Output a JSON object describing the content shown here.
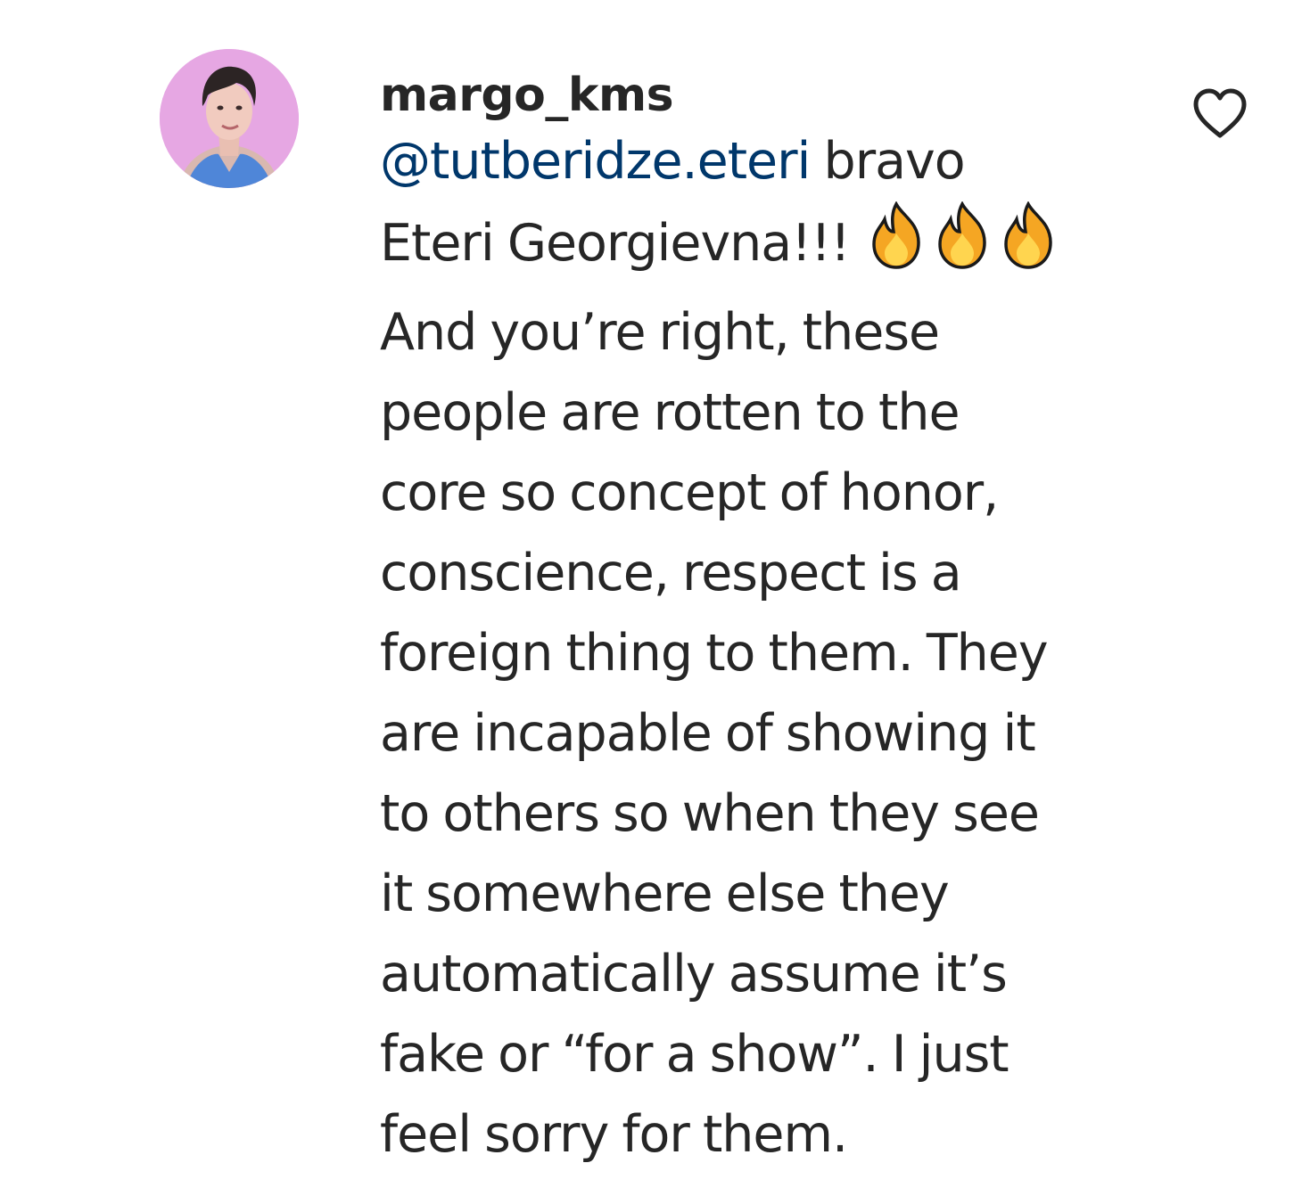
{
  "comment": {
    "username": "margo_kms",
    "mention": "@tutberidze.eteri",
    "text_line_1_after_mention": " bravo",
    "text_line_2": "Eteri Georgievna!!! ",
    "emoji": [
      "fire",
      "fire",
      "fire"
    ],
    "text_rest_lines": [
      "And you’re right, these",
      "people are rotten to the",
      "core so concept of honor,",
      "conscience, respect is a",
      "foreign thing to them. They",
      "are incapable of showing it",
      "to others so when they see",
      "it somewhere else they",
      "automatically assume it’s",
      "fake or “for a show”. I just",
      "feel sorry for them."
    ],
    "avatar_icon": "profile-photo",
    "like_icon": "heart-outline-icon"
  },
  "colors": {
    "text": "#262626",
    "mention": "#00376b",
    "avatar_bg": "#e6a7e3"
  }
}
